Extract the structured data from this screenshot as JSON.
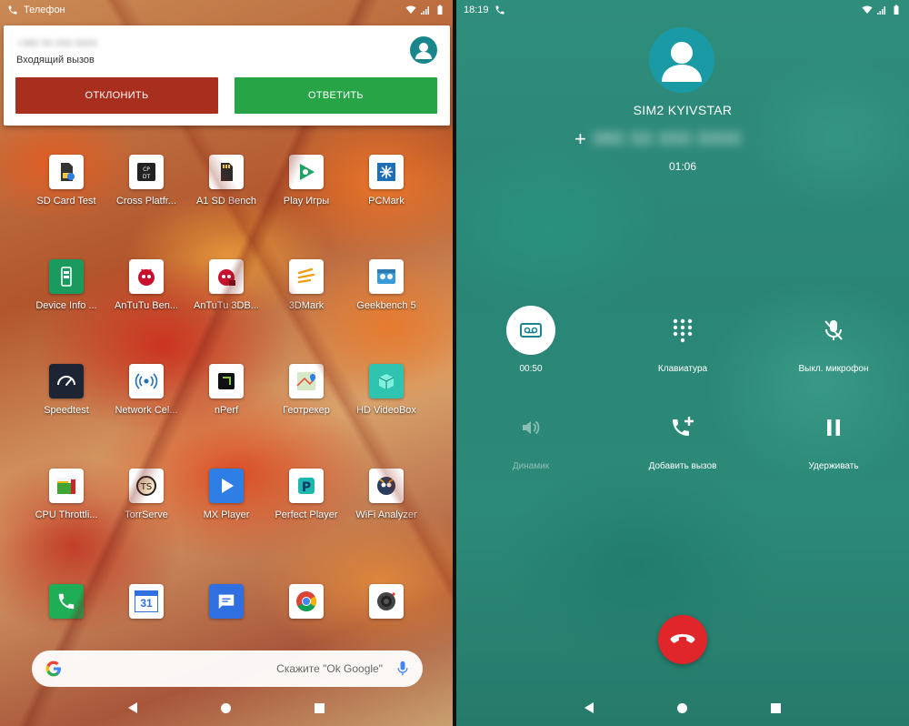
{
  "left_screen": {
    "status_bar": {
      "app_label": "Телефон"
    },
    "notification": {
      "caller_number": "+380 50 000 0000",
      "label": "Входящий вызов",
      "decline_label": "ОТКЛОНИТЬ",
      "answer_label": "ОТВЕТИТЬ"
    },
    "apps": [
      {
        "label": "SD Card Test",
        "icon": "sd-card-test-icon",
        "color": "#ffffff"
      },
      {
        "label": "Cross Platfr...",
        "icon": "cross-platform-icon",
        "color": "#ffffff"
      },
      {
        "label": "A1 SD Bench",
        "icon": "a1-sd-bench-icon",
        "color": "#ffffff"
      },
      {
        "label": "Play Игры",
        "icon": "play-games-icon",
        "color": "#ffffff"
      },
      {
        "label": "PCMark",
        "icon": "pcmark-icon",
        "color": "#ffffff"
      },
      {
        "label": "Device Info ...",
        "icon": "device-info-icon",
        "color": "#1b9a5f"
      },
      {
        "label": "AnTuTu Ben...",
        "icon": "antutu-icon",
        "color": "#ffffff"
      },
      {
        "label": "AnTuTu 3DB...",
        "icon": "antutu-3d-icon",
        "color": "#ffffff"
      },
      {
        "label": "3DMark",
        "icon": "3dmark-icon",
        "color": "#ffffff"
      },
      {
        "label": "Geekbench 5",
        "icon": "geekbench-icon",
        "color": "#ffffff"
      },
      {
        "label": "Speedtest",
        "icon": "speedtest-icon",
        "color": "#1d2433"
      },
      {
        "label": "Network Cel...",
        "icon": "network-cell-icon",
        "color": "#ffffff"
      },
      {
        "label": "nPerf",
        "icon": "nperf-icon",
        "color": "#ffffff"
      },
      {
        "label": "Геотрекер",
        "icon": "geotracker-icon",
        "color": "#ffffff"
      },
      {
        "label": "HD VideoBox",
        "icon": "hd-videobox-icon",
        "color": "#2ec4b0"
      },
      {
        "label": "CPU Throttli...",
        "icon": "cpu-throttling-icon",
        "color": "#ffffff"
      },
      {
        "label": "TorrServe",
        "icon": "torrserve-icon",
        "color": "#ffffff"
      },
      {
        "label": "MX Player",
        "icon": "mx-player-icon",
        "color": "#2f7ee6"
      },
      {
        "label": "Perfect Player",
        "icon": "perfect-player-icon",
        "color": "#ffffff"
      },
      {
        "label": "WiFi Analyzer",
        "icon": "wifi-analyzer-icon",
        "color": "#ffffff"
      }
    ],
    "dock": [
      {
        "icon": "phone-icon",
        "color": "#1fae55"
      },
      {
        "icon": "calendar-icon",
        "color": "#ffffff",
        "text": "31"
      },
      {
        "icon": "messages-icon",
        "color": "#2f6fe0"
      },
      {
        "icon": "chrome-icon",
        "color": "#ffffff"
      },
      {
        "icon": "camera-icon",
        "color": "#ffffff"
      }
    ],
    "search": {
      "hint": "Скажите \"Ok Google\""
    }
  },
  "right_screen": {
    "status_bar": {
      "time": "18:19"
    },
    "call": {
      "sim_label": "SIM2 KYIVSTAR",
      "number_prefix": "+",
      "number": "380 50 000 0000",
      "timer": "01:06"
    },
    "controls": {
      "record_label": "00:50",
      "keypad_label": "Клавиатура",
      "mute_label": "Выкл. микрофон",
      "speaker_label": "Динамик",
      "add_call_label": "Добавить вызов",
      "hold_label": "Удерживать"
    },
    "colors": {
      "end_call": "#e0262b",
      "decline": "#a82e1d",
      "answer": "#27a546",
      "accent_teal": "#19868c"
    }
  }
}
